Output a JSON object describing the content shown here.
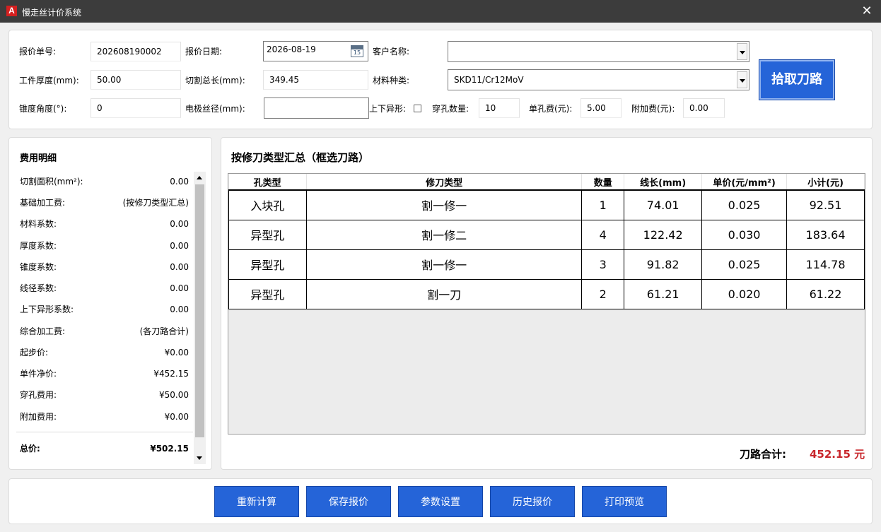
{
  "window": {
    "title": "慢走丝计价系统",
    "icon": "autocad-a-icon",
    "icon_glyph": "A"
  },
  "form": {
    "quote_no_label": "报价单号:",
    "quote_no_value": "202608190002",
    "quote_date_label": "报价日期:",
    "quote_date_value": "2026-08-19",
    "calendar_day": "15",
    "customer_label": "客户名称:",
    "customer_value": "",
    "thickness_label": "工件厚度(mm):",
    "thickness_value": "50.00",
    "cut_length_label": "切割总长(mm):",
    "cut_length_value": "349.45",
    "material_label": "材料种类:",
    "material_value": "SKD11/Cr12MoV",
    "taper_label": "锥度角度(°):",
    "taper_value": "0",
    "wire_diameter_label": "电极丝径(mm):",
    "wire_diameter_value": "",
    "upper_lower_label": "上下异形:",
    "upper_lower_checked": false,
    "threading_count_label": "穿孔数量:",
    "threading_count_value": "10",
    "unit_hole_fee_label": "单孔费(元):",
    "unit_hole_fee_value": "5.00",
    "extra_fee_label": "附加费(元):",
    "extra_fee_value": "0.00",
    "pick_path_button": "拾取刀路"
  },
  "cost_detail": {
    "title": "费用明细",
    "items": [
      {
        "label": "切割面积(mm²):",
        "value": "0.00"
      },
      {
        "label": "基础加工费:",
        "value": "(按修刀类型汇总)"
      },
      {
        "label": "材料系数:",
        "value": "0.00"
      },
      {
        "label": "厚度系数:",
        "value": "0.00"
      },
      {
        "label": "锥度系数:",
        "value": "0.00"
      },
      {
        "label": "线径系数:",
        "value": "0.00"
      },
      {
        "label": "上下异形系数:",
        "value": "0.00"
      },
      {
        "label": "综合加工费:",
        "value": "(各刀路合计)"
      },
      {
        "label": "起步价:",
        "value": "¥0.00"
      },
      {
        "label": "单件净价:",
        "value": "¥452.15"
      },
      {
        "label": "穿孔费用:",
        "value": "¥50.00"
      },
      {
        "label": "附加费用:",
        "value": "¥0.00"
      }
    ],
    "total_label": "总价:",
    "total_value": "¥502.15"
  },
  "summary": {
    "title": "按修刀类型汇总（框选刀路）",
    "columns": [
      "孔类型",
      "修刀类型",
      "数量",
      "线长(mm)",
      "单价(元/mm²)",
      "小计(元)"
    ],
    "rows": [
      [
        "入块孔",
        "割一修一",
        "1",
        "74.01",
        "0.025",
        "92.51"
      ],
      [
        "异型孔",
        "割一修二",
        "4",
        "122.42",
        "0.030",
        "183.64"
      ],
      [
        "异型孔",
        "割一修一",
        "3",
        "91.82",
        "0.025",
        "114.78"
      ],
      [
        "异型孔",
        "割一刀",
        "2",
        "61.21",
        "0.020",
        "61.22"
      ]
    ],
    "total_label": "刀路合计:",
    "total_value": "452.15 元"
  },
  "actions": {
    "recalculate": "重新计算",
    "save": "保存报价",
    "settings": "参数设置",
    "history": "历史报价",
    "print_preview": "打印预览"
  },
  "colors": {
    "titlebar": "#3c3c3c",
    "accent_blue": "#2564d8",
    "total_red": "#c8262b"
  }
}
